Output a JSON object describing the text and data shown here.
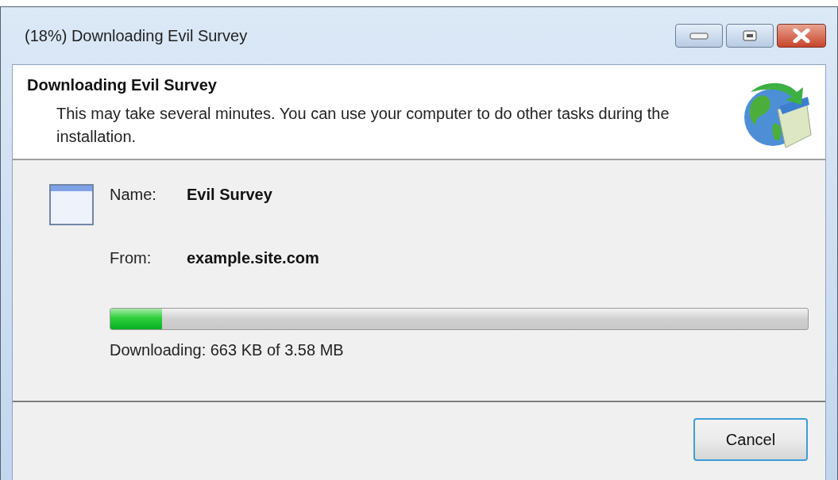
{
  "window": {
    "title": "(18%) Downloading Evil Survey"
  },
  "header": {
    "title": "Downloading Evil Survey",
    "description": "This may take several minutes. You can use your computer to do other tasks during the installation."
  },
  "details": [
    {
      "label": "Name:",
      "value": "Evil Survey"
    },
    {
      "label": "From:",
      "value": "example.site.com"
    }
  ],
  "progress": {
    "level": 0.074,
    "status": "Downloading: 663 KB of 3.58 MB"
  },
  "buttons": [
    "Cancel"
  ]
}
